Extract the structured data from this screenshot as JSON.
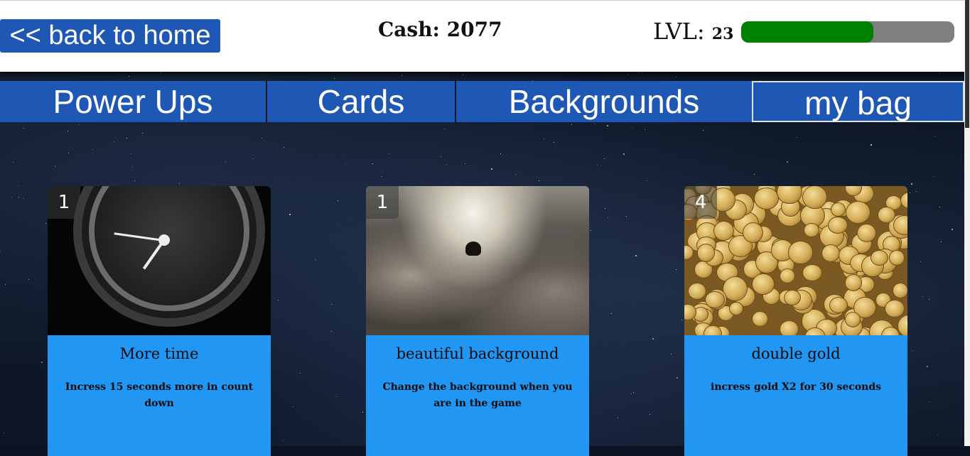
{
  "header": {
    "back_label": "<< back to home",
    "cash_label": "Cash: 2077",
    "level_label": "LVL:",
    "level_value": "23",
    "xp_progress_fraction": 0.62
  },
  "tabs": [
    {
      "label": "Power Ups"
    },
    {
      "label": "Cards"
    },
    {
      "label": "Backgrounds"
    },
    {
      "label": "my bag",
      "active": true
    }
  ],
  "cards": [
    {
      "count": "1",
      "title": "More time",
      "description": "Incress 15 seconds more in count down",
      "image": "clock"
    },
    {
      "count": "1",
      "title": "beautiful background",
      "description": "Change the background when you are in the game",
      "image": "cloudy-sky"
    },
    {
      "count": "4",
      "title": "double gold",
      "description": "incress gold X2 for 30 seconds",
      "image": "gold-coins"
    }
  ],
  "colors": {
    "primary_blue": "#1f57b5",
    "card_blue": "#2196f3",
    "xp_fill": "#008000",
    "xp_track": "#808080"
  }
}
